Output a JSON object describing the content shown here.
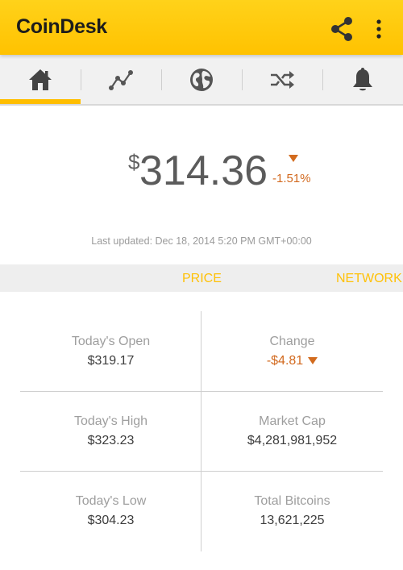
{
  "app": {
    "title": "CoinDesk",
    "accent_color": "#ffc200",
    "actions": [
      {
        "icon": "share-icon"
      },
      {
        "icon": "overflow-menu-icon"
      }
    ]
  },
  "tabs": [
    {
      "icon": "home-icon",
      "selected": true
    },
    {
      "icon": "chart-icon",
      "selected": false
    },
    {
      "icon": "globe-icon",
      "selected": false
    },
    {
      "icon": "shuffle-icon",
      "selected": false
    },
    {
      "icon": "bell-icon",
      "selected": false
    }
  ],
  "price": {
    "currency_symbol": "$",
    "value": "314.36",
    "change_percent": "-1.51%",
    "direction": "down",
    "down_color": "#d2691e",
    "last_updated": "Last updated: Dec 18, 2014 5:20 PM GMT+00:00"
  },
  "section_tabs": {
    "price_label": "PRICE",
    "network_label": "NETWORK",
    "color": "#ffc107"
  },
  "stats": [
    {
      "label": "Today's Open",
      "value": "$319.17"
    },
    {
      "label": "Change",
      "value": "-$4.81",
      "direction": "down"
    },
    {
      "label": "Today's High",
      "value": "$323.23"
    },
    {
      "label": "Market Cap",
      "value": "$4,281,981,952"
    },
    {
      "label": "Today's Low",
      "value": "$304.23"
    },
    {
      "label": "Total Bitcoins",
      "value": "13,621,225"
    }
  ]
}
